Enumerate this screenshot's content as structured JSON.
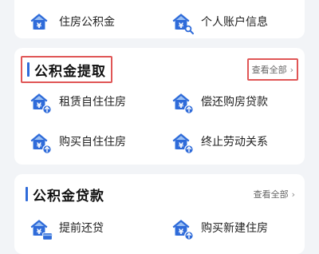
{
  "top_items": [
    {
      "label": "住房公积金",
      "icon": "house-yuan-icon"
    },
    {
      "label": "个人账户信息",
      "icon": "house-yuan-search-icon"
    }
  ],
  "withdraw": {
    "title": "公积金提取",
    "view_all": "查看全部",
    "items": [
      {
        "label": "租赁自住住房",
        "icon": "house-yuan-up-icon"
      },
      {
        "label": "偿还购房贷款",
        "icon": "house-yuan-up-icon"
      },
      {
        "label": "购买自住住房",
        "icon": "house-yuan-up-icon"
      },
      {
        "label": "终止劳动关系",
        "icon": "house-yuan-up-icon"
      }
    ]
  },
  "loan": {
    "title": "公积金贷款",
    "view_all": "查看全部",
    "items": [
      {
        "label": "提前还贷",
        "icon": "house-yuan-card-icon"
      },
      {
        "label": "购买新建住房",
        "icon": "house-yuan-up-icon"
      }
    ]
  },
  "colors": {
    "accent": "#2f6bd9",
    "highlight": "#e05656",
    "icon_blue": "#2f6bd9",
    "icon_light": "#9cc0f2"
  }
}
